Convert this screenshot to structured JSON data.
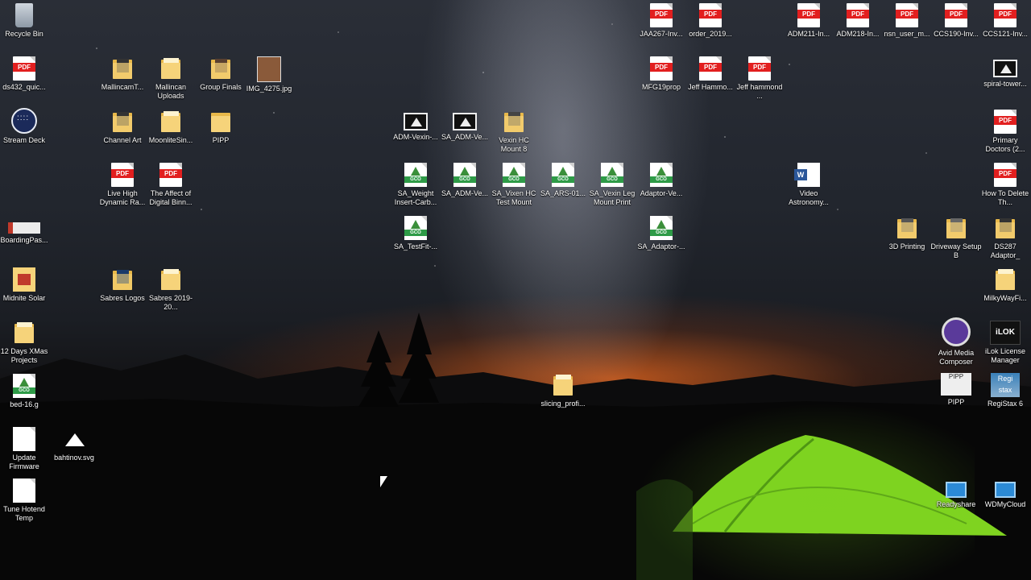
{
  "desktop": {
    "icons": [
      {
        "id": "recycle",
        "label": "Recycle Bin",
        "type": "recycle"
      },
      {
        "id": "ds432",
        "label": "ds432_quic...",
        "type": "pdf"
      },
      {
        "id": "stream",
        "label": "Stream Deck",
        "type": "stream"
      },
      {
        "id": "boarding",
        "label": "BoardingPas...",
        "type": "boarding"
      },
      {
        "id": "midnite",
        "label": "Midnite Solar",
        "type": "solar"
      },
      {
        "id": "xmas",
        "label": "12 Days XMas Projects",
        "type": "folder"
      },
      {
        "id": "bed",
        "label": "bed-16.g",
        "type": "gco"
      },
      {
        "id": "update",
        "label": "Update Firmware",
        "type": "blank"
      },
      {
        "id": "tune",
        "label": "Tune Hotend Temp",
        "type": "blank"
      },
      {
        "id": "mallincamt",
        "label": "MallincamT...",
        "type": "folder-img"
      },
      {
        "id": "channelart",
        "label": "Channel Art",
        "type": "folder-img"
      },
      {
        "id": "livehigh",
        "label": "Live High Dynamic Ra...",
        "type": "pdf"
      },
      {
        "id": "sabreslogos",
        "label": "Sabres Logos",
        "type": "folder-img"
      },
      {
        "id": "bahtinov",
        "label": "bahtinov.svg",
        "type": "svg"
      },
      {
        "id": "mallincanup",
        "label": "Mallincan Uploads",
        "type": "folder"
      },
      {
        "id": "moonlite",
        "label": "MoonliteSin...",
        "type": "folder"
      },
      {
        "id": "affect",
        "label": "The Affect of Digital Binn...",
        "type": "pdf"
      },
      {
        "id": "sabres2019",
        "label": "Sabres 2019-20...",
        "type": "folder"
      },
      {
        "id": "groupfinals",
        "label": "Group Finals",
        "type": "folder-img"
      },
      {
        "id": "pipp_folder",
        "label": "PIPP",
        "type": "folder"
      },
      {
        "id": "img4275",
        "label": "IMG_4275.jpg",
        "type": "image"
      },
      {
        "id": "admvexin",
        "label": "ADM-Vexin-...",
        "type": "frame"
      },
      {
        "id": "saweight",
        "label": "SA_Weight Insert-Carb...",
        "type": "gco"
      },
      {
        "id": "satestfit",
        "label": "SA_TestFit-...",
        "type": "gco"
      },
      {
        "id": "saadmve1",
        "label": "SA_ADM-Ve...",
        "type": "frame"
      },
      {
        "id": "saadmve2",
        "label": "SA_ADM-Ve...",
        "type": "gco"
      },
      {
        "id": "vexinhc",
        "label": "Vexin HC Mount 8",
        "type": "folder-img"
      },
      {
        "id": "savixen",
        "label": "SA_Vixen HC Test Mount",
        "type": "gco"
      },
      {
        "id": "saars",
        "label": "SA_ARS-01...",
        "type": "gco"
      },
      {
        "id": "slicing",
        "label": "slicing_profi...",
        "type": "folder"
      },
      {
        "id": "savexinleg",
        "label": "SA_Vexin Leg Mount Print",
        "type": "gco"
      },
      {
        "id": "jaa267",
        "label": "JAA267-Inv...",
        "type": "pdf"
      },
      {
        "id": "mfg19",
        "label": "MFG19prop",
        "type": "pdf"
      },
      {
        "id": "adaptorve",
        "label": "Adaptor-Ve...",
        "type": "gco"
      },
      {
        "id": "saadaptor",
        "label": "SA_Adaptor-...",
        "type": "gco"
      },
      {
        "id": "order2019",
        "label": "order_2019...",
        "type": "pdf"
      },
      {
        "id": "jeffhammo",
        "label": "Jeff Hammo...",
        "type": "pdf"
      },
      {
        "id": "jeffhammond",
        "label": "Jeff hammond ...",
        "type": "pdf"
      },
      {
        "id": "videoastro",
        "label": "Video Astronomy...",
        "type": "word"
      },
      {
        "id": "adm211",
        "label": "ADM211-In...",
        "type": "pdf"
      },
      {
        "id": "adm218",
        "label": "ADM218-In...",
        "type": "pdf"
      },
      {
        "id": "nsnuser",
        "label": "nsn_user_m...",
        "type": "pdf"
      },
      {
        "id": "printing3d",
        "label": "3D Printing",
        "type": "folder-img"
      },
      {
        "id": "ccs190",
        "label": "CCS190-Inv...",
        "type": "pdf"
      },
      {
        "id": "driveway",
        "label": "Driveway Setup B",
        "type": "folder-img"
      },
      {
        "id": "avid",
        "label": "Avid Media Composer",
        "type": "avid"
      },
      {
        "id": "pipp_app",
        "label": "PIPP",
        "type": "pipp"
      },
      {
        "id": "readyshare",
        "label": "Readyshare",
        "type": "net"
      },
      {
        "id": "ccs121",
        "label": "CCS121-Inv...",
        "type": "pdf"
      },
      {
        "id": "spiral",
        "label": "spiral-tower...",
        "type": "frame"
      },
      {
        "id": "primary",
        "label": "Primary Doctors (2...",
        "type": "pdf"
      },
      {
        "id": "howto",
        "label": "How To Delete Th...",
        "type": "pdf"
      },
      {
        "id": "ds287",
        "label": "DS287 Adaptor_",
        "type": "folder-img"
      },
      {
        "id": "milkyway",
        "label": "MilkyWayFi...",
        "type": "folder"
      },
      {
        "id": "ilok",
        "label": "iLok License Manager",
        "type": "ilok"
      },
      {
        "id": "registax",
        "label": "RegiStax 6",
        "type": "regi"
      },
      {
        "id": "wdmycloud",
        "label": "WDMyCloud",
        "type": "net"
      }
    ],
    "glyphs": {
      "pdf_tag": "PDF",
      "gco_tag": "GCO",
      "word_tag": "W",
      "ilok_text": "iLOK",
      "pipp_text": "PIPP",
      "regi_text": "Regi stax"
    }
  }
}
